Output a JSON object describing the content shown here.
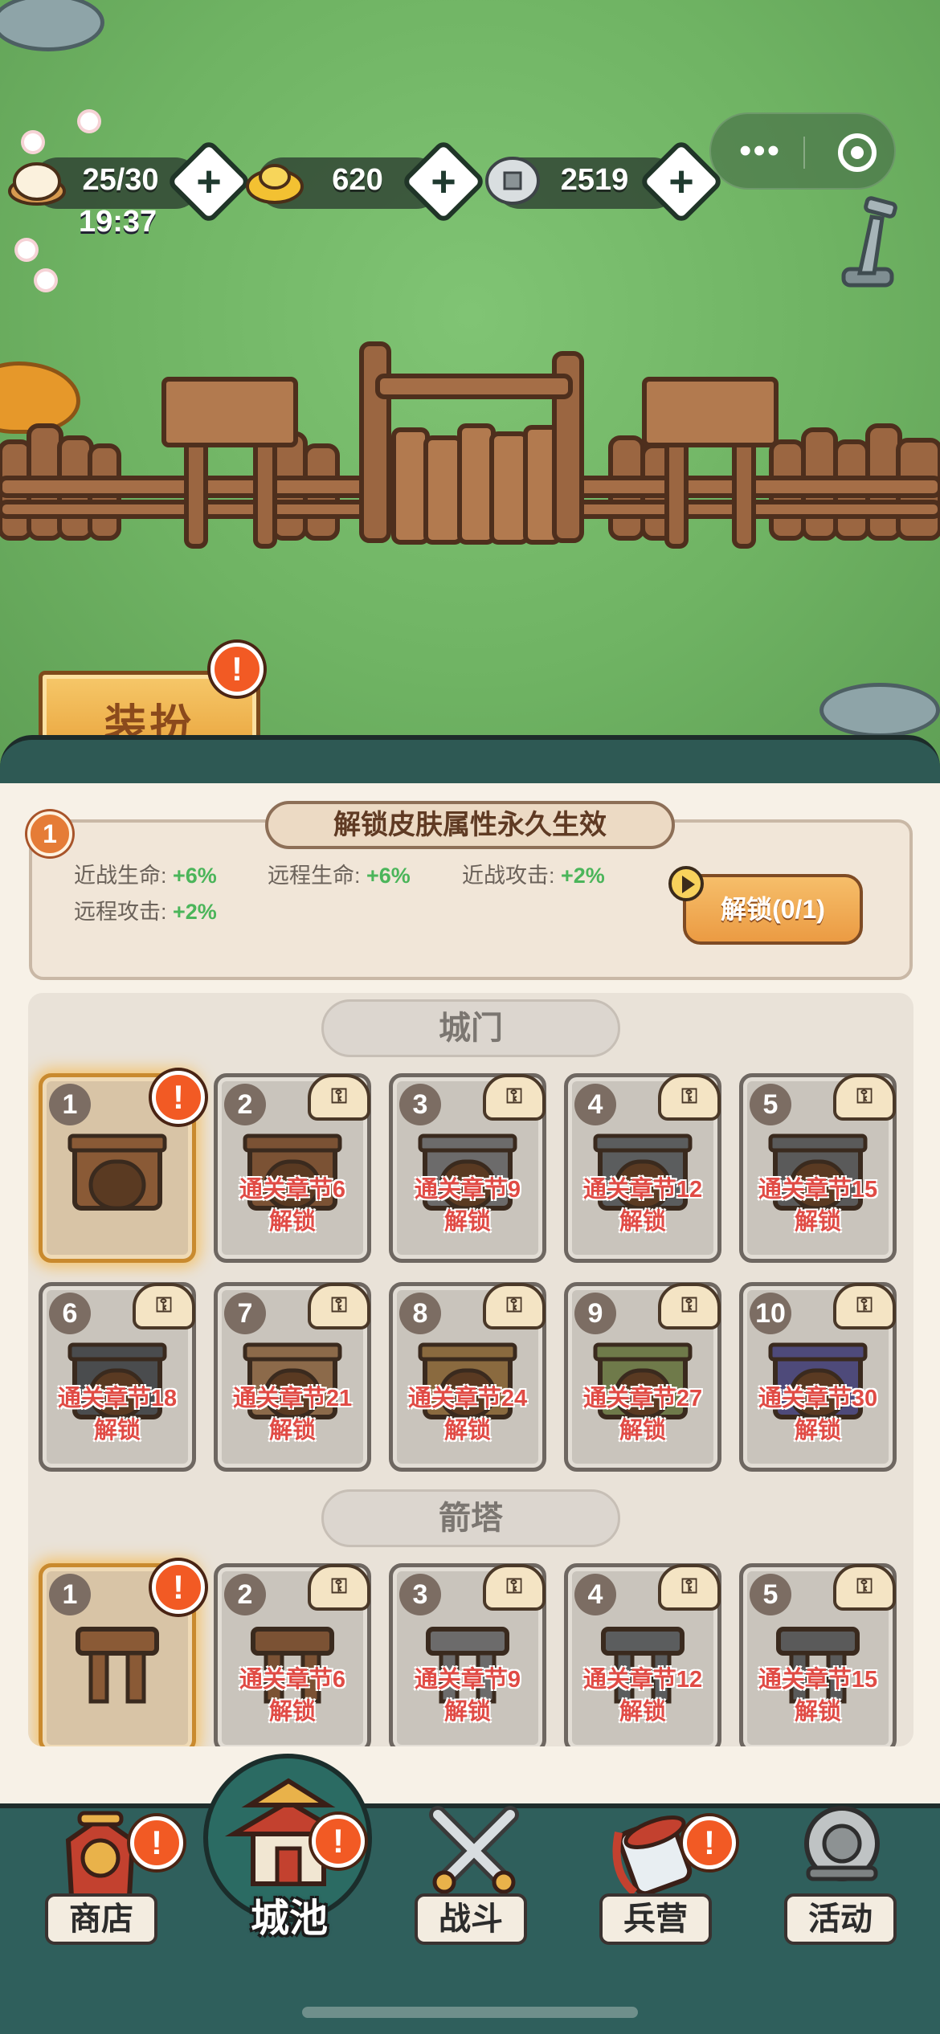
{
  "resources": {
    "stamina": "25/30",
    "gold": "620",
    "silver": "2519",
    "timer": "19:37",
    "plus_label": "+"
  },
  "capsule": {
    "menu_label": "•••"
  },
  "dress_button": {
    "label": "装扮",
    "badge": "!"
  },
  "unlock": {
    "index": "1",
    "title": "解锁皮肤属性永久生效",
    "stats": [
      {
        "label": "近战生命: ",
        "value": "+6%"
      },
      {
        "label": "远程生命: ",
        "value": "+6%"
      },
      {
        "label": "近战攻击: ",
        "value": "+2%"
      },
      {
        "label": "远程攻击: ",
        "value": "+2%"
      }
    ],
    "button": "解锁(0/1)"
  },
  "sections": {
    "gate": {
      "title": "城门",
      "slots": [
        {
          "num": "1",
          "req": "",
          "unlock": ""
        },
        {
          "num": "2",
          "req": "通关章节6",
          "unlock": "解锁"
        },
        {
          "num": "3",
          "req": "通关章节9",
          "unlock": "解锁"
        },
        {
          "num": "4",
          "req": "通关章节12",
          "unlock": "解锁"
        },
        {
          "num": "5",
          "req": "通关章节15",
          "unlock": "解锁"
        },
        {
          "num": "6",
          "req": "通关章节18",
          "unlock": "解锁"
        },
        {
          "num": "7",
          "req": "通关章节21",
          "unlock": "解锁"
        },
        {
          "num": "8",
          "req": "通关章节24",
          "unlock": "解锁"
        },
        {
          "num": "9",
          "req": "通关章节27",
          "unlock": "解锁"
        },
        {
          "num": "10",
          "req": "通关章节30",
          "unlock": "解锁"
        }
      ]
    },
    "tower": {
      "title": "箭塔",
      "slots": [
        {
          "num": "1",
          "req": "",
          "unlock": ""
        },
        {
          "num": "2",
          "req": "通关章节6",
          "unlock": "解锁"
        },
        {
          "num": "3",
          "req": "通关章节9",
          "unlock": "解锁"
        },
        {
          "num": "4",
          "req": "通关章节12",
          "unlock": "解锁"
        },
        {
          "num": "5",
          "req": "通关章节15",
          "unlock": "解锁"
        }
      ]
    }
  },
  "nav": {
    "shop": "商店",
    "city": "城池",
    "battle": "战斗",
    "barracks": "兵营",
    "events": "活动"
  },
  "badge_mark": "!"
}
